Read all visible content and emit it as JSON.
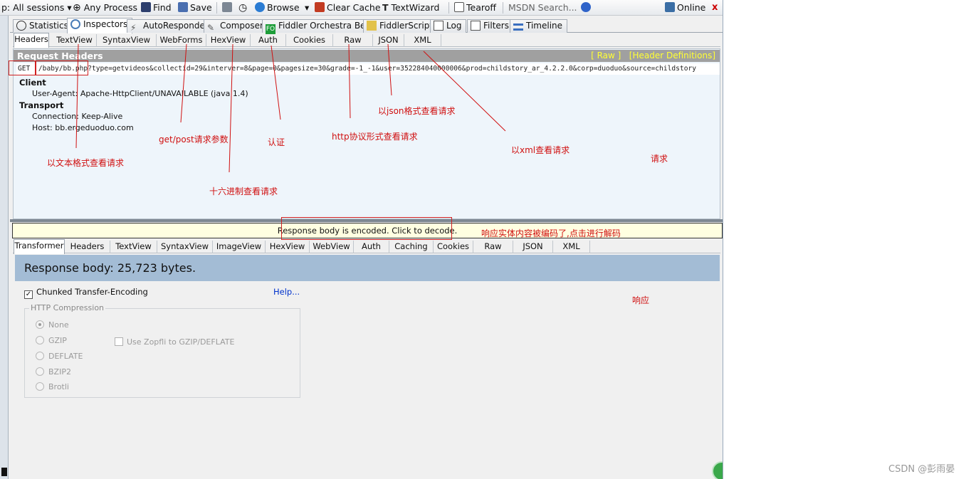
{
  "toolbar": {
    "sessions": "p: All sessions",
    "any_process": "Any Process",
    "find": "Find",
    "save": "Save",
    "browse": "Browse",
    "clear_cache": "Clear Cache",
    "textwizard": "TextWizard",
    "tearoff": "Tearoff",
    "msdn_search": "MSDN Search...",
    "online": "Online",
    "close": "x"
  },
  "main_tabs": [
    "Statistics",
    "Inspectors",
    "AutoResponder",
    "Composer",
    "Fiddler Orchestra Beta",
    "FiddlerScript",
    "Log",
    "Filters",
    "Timeline"
  ],
  "request": {
    "tabs": [
      "Headers",
      "TextView",
      "SyntaxView",
      "WebForms",
      "HexView",
      "Auth",
      "Cookies",
      "Raw",
      "JSON",
      "XML"
    ],
    "headers_title": "Request Headers",
    "raw_link": "[ Raw ]",
    "header_defs_link": "[Header Definitions]",
    "method": "GET",
    "url": "/baby/bb.php?type=getvideos&collectid=29&interver=8&page=0&pagesize=30&grade=-1_-1&user=352284040000006&prod=childstory_ar_4.2.2.0&corp=duoduo&source=childstory",
    "groups": [
      {
        "name": "Client",
        "items": [
          "User-Agent: Apache-HttpClient/UNAVAILABLE (java 1.4)"
        ]
      },
      {
        "name": "Transport",
        "items": [
          "Connection: Keep-Alive",
          "Host: bb.ergeduoduo.com"
        ]
      }
    ]
  },
  "response": {
    "encoded_notice": "Response body is encoded. Click to decode.",
    "tabs": [
      "Transformer",
      "Headers",
      "TextView",
      "SyntaxView",
      "ImageView",
      "HexView",
      "WebView",
      "Auth",
      "Caching",
      "Cookies",
      "Raw",
      "JSON",
      "XML"
    ],
    "body_size": "Response body: 25,723 bytes.",
    "chunked_label": "Chunked Transfer-Encoding",
    "chunked_checked": true,
    "help_link": "Help...",
    "compression_title": "HTTP Compression",
    "compression_options": [
      "None",
      "GZIP",
      "DEFLATE",
      "BZIP2",
      "Brotli"
    ],
    "compression_selected": "None",
    "zopfli_label": "Use Zopfli to GZIP/DEFLATE"
  },
  "annotations": {
    "textview": "以文本格式查看请求",
    "webforms": "get/post请求参数",
    "hexview": "十六进制查看请求",
    "auth": "认证",
    "raw": "http协议形式查看请求",
    "json": "以json格式查看请求",
    "xml": "以xml查看请求",
    "request": "请求",
    "encoded": "响应实体内容被编码了,点击进行解码",
    "response": "响应"
  },
  "watermark": "CSDN @彭雨晏",
  "colors": {
    "annotation": "#d01010",
    "response_banner": "#a3bcd5",
    "request_header_bar": "#a0a0a0",
    "header_links": "#ffff33",
    "encoded_bar": "#ffffe1"
  }
}
